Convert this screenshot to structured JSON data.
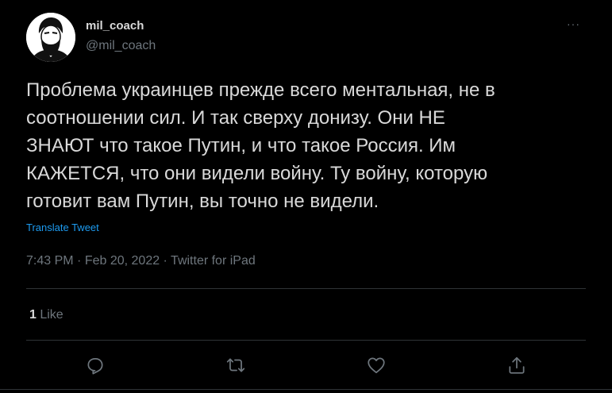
{
  "author": {
    "display_name": "mil_coach",
    "handle": "@mil_coach"
  },
  "tweet": {
    "text": "Проблема украинцев прежде всего ментальная, не в\nсоотношении сил. И так сверху донизу. Они НЕ\nЗНАЮТ что такое Путин, и что такое Россия. Им\nКАЖЕТСЯ, что они видели войну. Ту войну, которую\nготовит вам Путин, вы точно не видели.",
    "translate_label": "Translate Tweet",
    "time": "7:43 PM",
    "date": "Feb 20, 2022",
    "source": "Twitter for iPad",
    "separator": " · "
  },
  "stats": {
    "like_count": "1",
    "like_label": " Like"
  },
  "menu": {
    "more_label": "···"
  },
  "icons": {
    "avatar": "avatar-illustration",
    "reply": "reply-icon",
    "retweet": "retweet-icon",
    "like": "heart-icon",
    "share": "share-icon"
  },
  "colors": {
    "background": "#000000",
    "text": "#d9d9d9",
    "secondary": "#6e767d",
    "link": "#1d9bf0",
    "divider": "#2f3336"
  }
}
